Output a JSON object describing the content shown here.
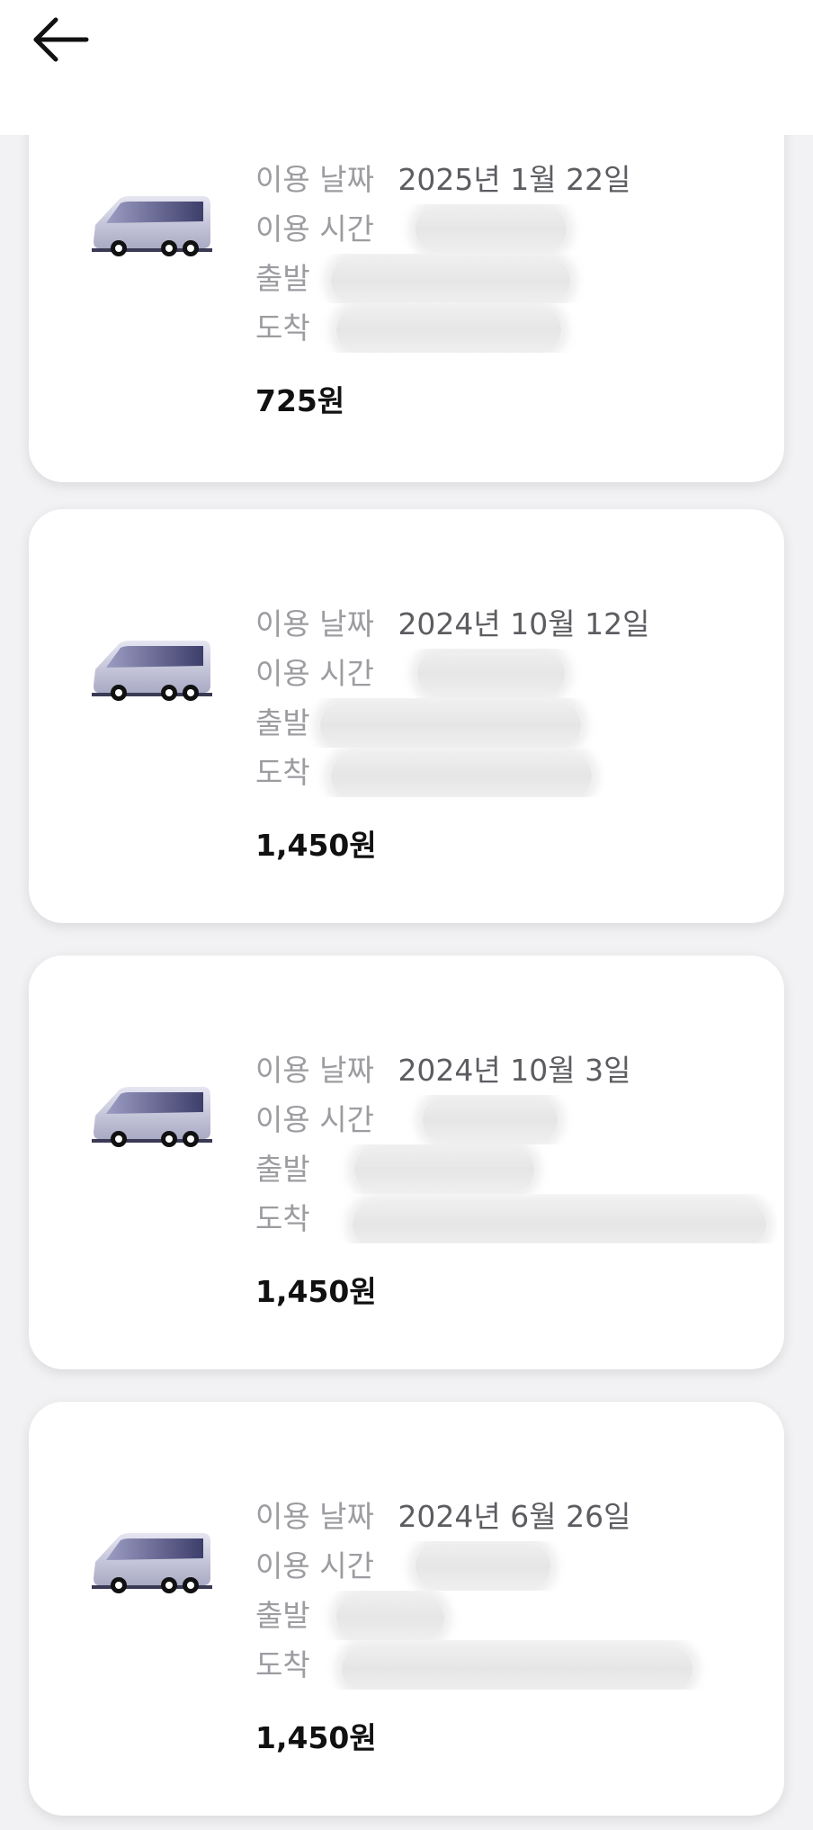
{
  "header": {
    "back_icon": "arrow-left-icon"
  },
  "labels": {
    "date": "이용 날짜",
    "time": "이용 시간",
    "departure": "출발",
    "arrival": "도착"
  },
  "rides": [
    {
      "date": "2025년 1월 22일",
      "price": "725원",
      "vehicle_icon": "van-icon"
    },
    {
      "date": "2024년 10월 12일",
      "price": "1,450원",
      "vehicle_icon": "van-icon"
    },
    {
      "date": "2024년 10월 3일",
      "price": "1,450원",
      "vehicle_icon": "van-icon"
    },
    {
      "date": "2024년 6월 26일",
      "price": "1,450원",
      "vehicle_icon": "van-icon"
    }
  ]
}
